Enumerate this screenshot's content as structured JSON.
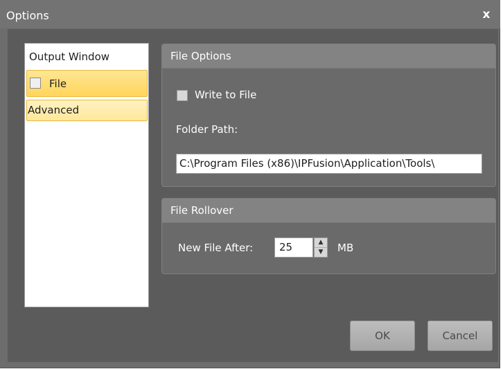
{
  "window": {
    "title": "Options",
    "close_glyph": "x"
  },
  "nav": {
    "header": "Output Window",
    "items": [
      {
        "label": "File",
        "checked": false
      },
      {
        "label": "Advanced"
      }
    ]
  },
  "file_options": {
    "title": "File Options",
    "write_to_file_label": "Write to File",
    "write_to_file_checked": false,
    "folder_path_label": "Folder Path:",
    "folder_path_value": "C:\\Program Files (x86)\\IPFusion\\Application\\Tools\\"
  },
  "file_rollover": {
    "title": "File Rollover",
    "new_file_after_label": "New File After:",
    "new_file_after_value": "25",
    "unit": "MB"
  },
  "buttons": {
    "ok": "OK",
    "cancel": "Cancel"
  },
  "colors": {
    "highlight": "#ffd65a",
    "background": "#5b5b5b"
  }
}
